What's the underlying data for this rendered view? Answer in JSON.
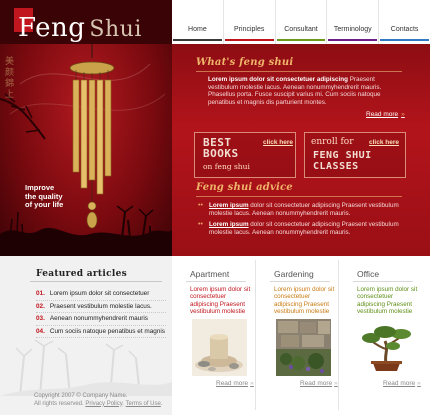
{
  "logo": {
    "word1": "Feng",
    "word2": "Shui"
  },
  "nav": {
    "items": [
      {
        "label": "Home",
        "bar": "#3a3a3a"
      },
      {
        "label": "Principles",
        "bar": "#c0141c"
      },
      {
        "label": "Consultant",
        "bar": "#6a9a1c"
      },
      {
        "label": "Terminology",
        "bar": "#6b1f8a"
      },
      {
        "label": "Contacts",
        "bar": "#2f7ac3"
      }
    ]
  },
  "hero": {
    "tagline": "Improve\nthe quality\nof your life",
    "glyphs": "美\n颜\n錦\n上",
    "intro": {
      "title": "What's feng shui",
      "bold": "Lorem ipsum dolor sit consectetuer adipiscing",
      "text": " Praesent vestibulum molestie lacus. Aenean nonummyhendrerit mauris. Phasellus porta. Fusce suscipit varius mi. Cum sociis natoque penatibus et magnis dis parturient montes.",
      "read_more": "Read more",
      "read_more_arrow": "»"
    },
    "promo_books": {
      "line1": "BEST",
      "line2": "BOOKS",
      "sub": "on feng shui",
      "link": "click here"
    },
    "promo_classes": {
      "line0": "enroll for",
      "line1": "FENG SHUI",
      "line2": "CLASSES",
      "link": "click here"
    },
    "advice": {
      "title": "Feng shui advice",
      "items": [
        {
          "link": "Lorem ipsum",
          "text": " dolor sit consectetuer adipiscing Praesent vestibulum molestie lacus. Aenean nonummyhendrerit mauris."
        },
        {
          "link": "Lorem ipsum",
          "text": " dolor sit consectetuer adipiscing Praesent vestibulum molestie lacus. Aenean nonummyhendrerit mauris."
        }
      ]
    }
  },
  "featured": {
    "title": "Featured articles",
    "items": [
      {
        "num": "01.",
        "text": "Lorem ipsum dolor sit consectetuer"
      },
      {
        "num": "02.",
        "text": "Praesent vestibulum molestie lacus."
      },
      {
        "num": "03.",
        "text": "Aenean nonummyhendrerit mauris"
      },
      {
        "num": "04.",
        "text": "Cum sociis natoque penatibus et magnis"
      }
    ]
  },
  "copyright": {
    "line1": "Copyright 2007 © Company Name.",
    "line2_prefix": "All rights reserved. ",
    "privacy": "Privacy Policy",
    "sep": ". ",
    "terms": "Terms of Use",
    "end": "."
  },
  "cards": [
    {
      "title": "Apartment",
      "text": "Lorem ipsum dolor sit consectetuer adipiscing Praesent vestibulum molestie",
      "color": "#c0141c",
      "read_more": "Read more",
      "arrow": "»"
    },
    {
      "title": "Gardening",
      "text": "Lorem ipsum dolor sit consectetuer adipiscing Praesent vestibulum molestie",
      "color": "#c97a10",
      "read_more": "Read more",
      "arrow": "»"
    },
    {
      "title": "Office",
      "text": "Lorem ipsum dolor sit consectetuer adipiscing Praesent vestibulum molestie",
      "color": "#5e8f17",
      "read_more": "Read more",
      "arrow": "»"
    }
  ]
}
